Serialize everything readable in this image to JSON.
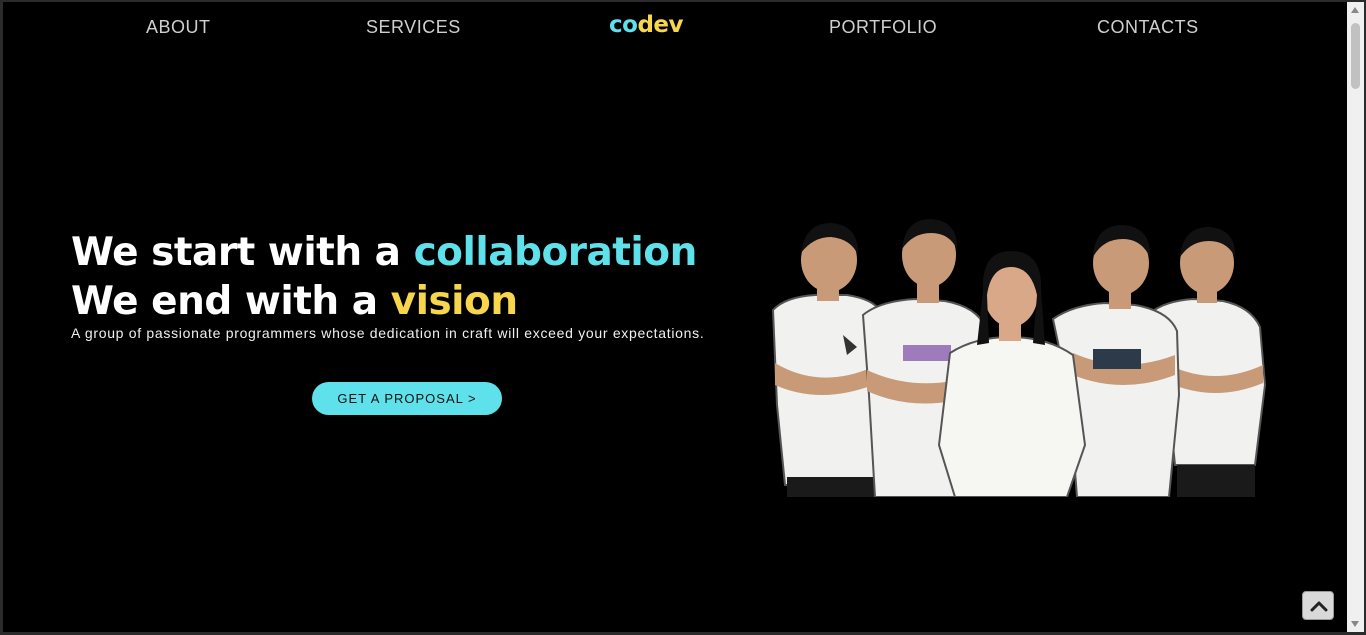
{
  "nav": {
    "items": [
      {
        "label": "ABOUT"
      },
      {
        "label": "SERVICES"
      },
      {
        "label": "PORTFOLIO"
      },
      {
        "label": "CONTACTS"
      }
    ],
    "logo": {
      "part1": "co",
      "part2": "dev"
    }
  },
  "hero": {
    "line1_prefix": "We start with a ",
    "line1_accent": "collaboration",
    "line2_prefix": "We end with a ",
    "line2_accent": "vision",
    "subtext": "A group of passionate programmers whose dedication in craft will exceed your expectations.",
    "cta_label": "GET A PROPOSAL >"
  },
  "colors": {
    "background": "#000000",
    "accent_cyan": "#5ee1ea",
    "accent_yellow": "#f7d64d",
    "nav_text": "#cfcfcf"
  },
  "icons": {
    "back_to_top": "chevron-up-icon"
  }
}
